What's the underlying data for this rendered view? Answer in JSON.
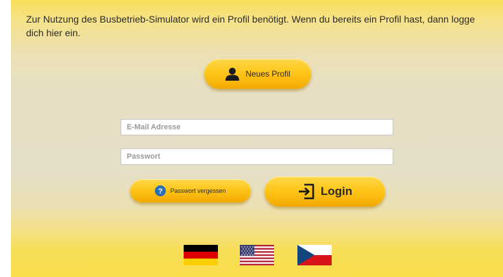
{
  "intro": {
    "text": "Zur Nutzung des Busbetrieb-Simulator wird ein Profil benötigt. Wenn du bereits ein Profil hast, dann logge dich hier ein."
  },
  "new_profile": {
    "label": "Neues Profil",
    "icon": "user-icon"
  },
  "login_form": {
    "email_placeholder": "E-Mail Adresse",
    "email_value": "",
    "password_placeholder": "Passwort",
    "password_value": ""
  },
  "forgot_password": {
    "label": "Passwort vergessen",
    "icon": "question-circle-icon"
  },
  "login": {
    "label": "Login",
    "icon": "sign-in-icon"
  },
  "languages": [
    "flag-germany-icon",
    "flag-usa-icon",
    "flag-czech-icon"
  ],
  "colors": {
    "button_yellow": "#ffc61a",
    "question_blue": "#2a6fb5",
    "background": "#e6dfc6"
  }
}
